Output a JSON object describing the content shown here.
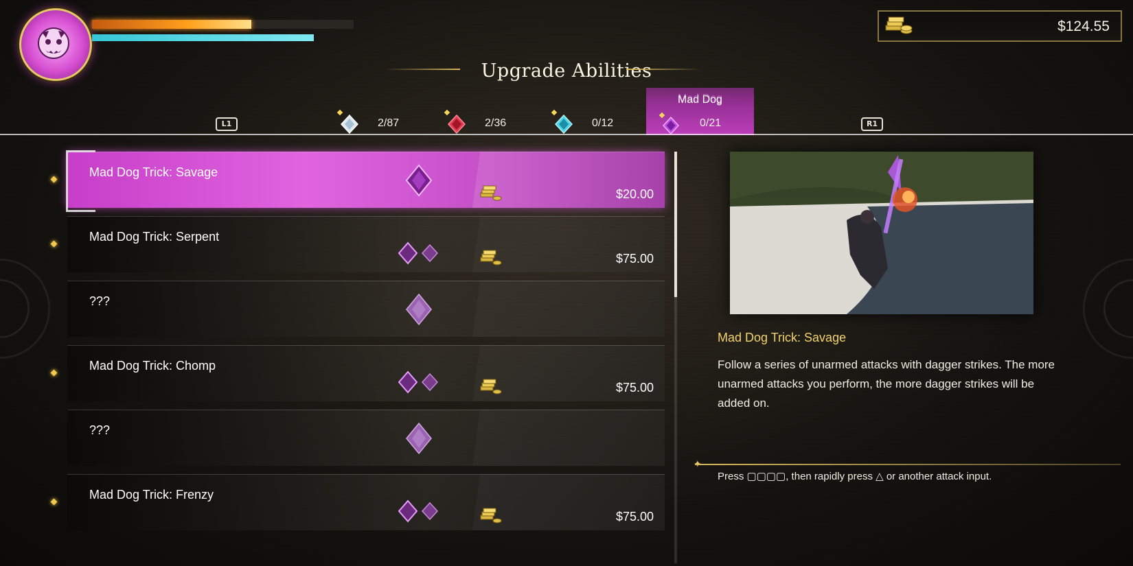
{
  "hud": {
    "health_pct": 0.61,
    "heat_pct": 1.0,
    "money": "$124.55"
  },
  "screen": {
    "title": "Upgrade Abilities"
  },
  "tabs": {
    "left_button": "L1",
    "right_button": "R1",
    "items": [
      {
        "gem": "white-gem-icon",
        "count": "2/87",
        "color": "#dfe8f0"
      },
      {
        "gem": "red-gem-icon",
        "count": "2/36",
        "color": "#e03a4e"
      },
      {
        "gem": "cyan-gem-icon",
        "count": "0/12",
        "color": "#4fd3e6"
      },
      {
        "gem": "purple-gem-icon",
        "count": "0/21",
        "color": "#c24de3",
        "label": "Mad Dog",
        "active": true
      }
    ]
  },
  "abilities": [
    {
      "name": "Mad Dog Trick: Savage",
      "price": "$20.00",
      "gems": 1,
      "selected": true
    },
    {
      "name": "Mad Dog Trick: Serpent",
      "price": "$75.00",
      "gems": 2
    },
    {
      "name": "???",
      "price": "",
      "gems": 1,
      "locked": true
    },
    {
      "name": "Mad Dog Trick: Chomp",
      "price": "$75.00",
      "gems": 2
    },
    {
      "name": "???",
      "price": "",
      "gems": 1,
      "locked": true
    },
    {
      "name": "Mad Dog Trick: Frenzy",
      "price": "$75.00",
      "gems": 2
    }
  ],
  "detail": {
    "title": "Mad Dog Trick: Savage",
    "description": "Follow a series of unarmed attacks with dagger strikes. The more unarmed attacks you perform, the more dagger strikes will be added on.",
    "input_prefix": "Press ",
    "input_sequence": "▢▢▢▢",
    "input_mid": ", then rapidly press ",
    "input_button": "△",
    "input_suffix": " or another attack input."
  },
  "colors": {
    "accent_purple": "#c73ec8",
    "gold": "#f2d36b",
    "health": "#ff9f1c",
    "heat": "#36c6d6"
  }
}
